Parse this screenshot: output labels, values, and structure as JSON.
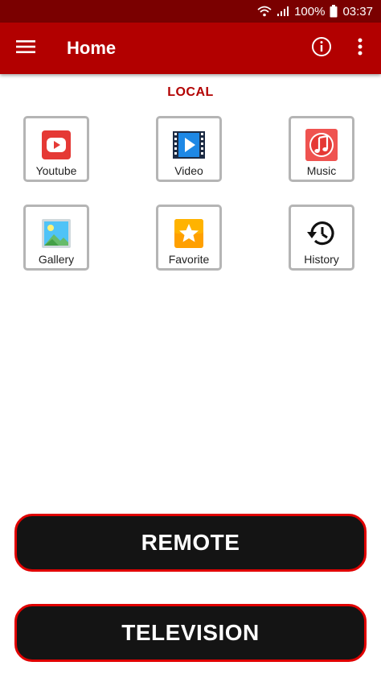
{
  "status": {
    "battery": "100%",
    "time": "03:37"
  },
  "appbar": {
    "title": "Home"
  },
  "section": {
    "label": "LOCAL"
  },
  "grid": {
    "items": [
      {
        "label": "Youtube",
        "icon": "youtube-icon"
      },
      {
        "label": "Video",
        "icon": "video-icon"
      },
      {
        "label": "Music",
        "icon": "music-icon"
      },
      {
        "label": "Gallery",
        "icon": "gallery-icon"
      },
      {
        "label": "Favorite",
        "icon": "star-icon"
      },
      {
        "label": "History",
        "icon": "history-icon"
      }
    ]
  },
  "actions": {
    "remote": "REMOTE",
    "television": "TELEVISION"
  },
  "colors": {
    "statusbar": "#7a0000",
    "appbar": "#b20000",
    "accent": "#e00000",
    "button_bg": "#141414"
  }
}
